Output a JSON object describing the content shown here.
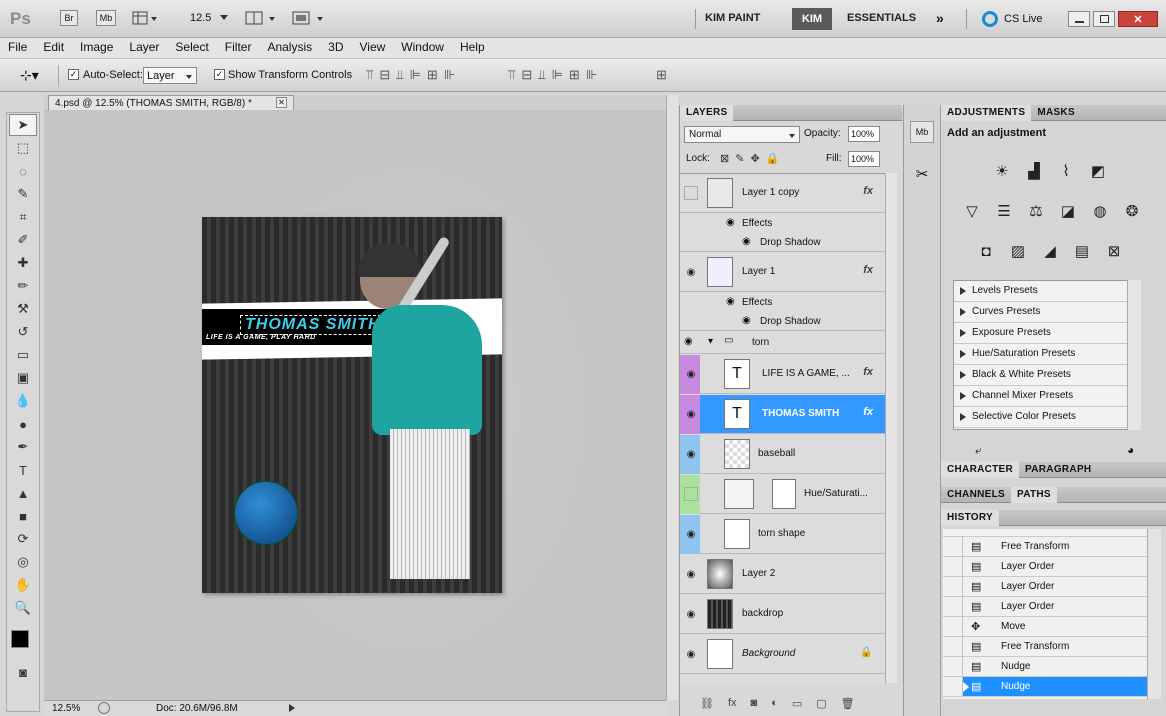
{
  "appbar": {
    "logo": "Ps",
    "bridge": "Br",
    "minibridge": "Mb",
    "zoom": "12.5",
    "workspaces": [
      "KIM PAINT",
      "KIM",
      "ESSENTIALS"
    ],
    "cslive": "CS Live"
  },
  "menu": [
    "File",
    "Edit",
    "Image",
    "Layer",
    "Select",
    "Filter",
    "Analysis",
    "3D",
    "View",
    "Window",
    "Help"
  ],
  "options": {
    "auto_select_label": "Auto-Select:",
    "auto_select_value": "Layer",
    "show_transform": "Show Transform Controls"
  },
  "document": {
    "tab_title": "4.psd @ 12.5% (THOMAS SMITH, RGB/8) *",
    "zoom_status": "12.5%",
    "doc_info": "Doc: 20.6M/96.8M",
    "art_title": "THOMAS SMITH",
    "art_tagline": "LIFE IS A GAME, PLAY HARD"
  },
  "layers_panel": {
    "tab": "LAYERS",
    "blend_mode": "Normal",
    "opacity_label": "Opacity:",
    "opacity": "100%",
    "lock_label": "Lock:",
    "fill_label": "Fill:",
    "fill": "100%",
    "layers": [
      {
        "name": "Layer 1 copy",
        "fx": true
      },
      {
        "name": "Effects"
      },
      {
        "name": "Drop Shadow"
      },
      {
        "name": "Layer 1",
        "fx": true
      },
      {
        "name": "Effects"
      },
      {
        "name": "Drop Shadow"
      },
      {
        "name": "torn"
      },
      {
        "name": "LIFE IS A GAME, ...",
        "fx": true
      },
      {
        "name": "THOMAS SMITH",
        "fx": true
      },
      {
        "name": "baseball"
      },
      {
        "name": "Hue/Saturati..."
      },
      {
        "name": "torn shape"
      },
      {
        "name": "Layer 2"
      },
      {
        "name": "backdrop"
      },
      {
        "name": "Background"
      }
    ],
    "text_thumb": "T"
  },
  "adjustments": {
    "tabs": [
      "ADJUSTMENTS",
      "MASKS"
    ],
    "heading": "Add an adjustment",
    "presets": [
      "Levels Presets",
      "Curves Presets",
      "Exposure Presets",
      "Hue/Saturation Presets",
      "Black & White Presets",
      "Channel Mixer Presets",
      "Selective Color Presets"
    ]
  },
  "char_tabs": [
    "CHARACTER",
    "PARAGRAPH"
  ],
  "chan_tabs": [
    "CHANNELS",
    "PATHS"
  ],
  "history": {
    "tab": "HISTORY",
    "items": [
      "Free Transform",
      "Layer Order",
      "Layer Order",
      "Layer Order",
      "Move",
      "Free Transform",
      "Nudge",
      "Nudge"
    ]
  },
  "colors": {
    "accent": "#3399ff",
    "selected": "#1e90ff"
  }
}
